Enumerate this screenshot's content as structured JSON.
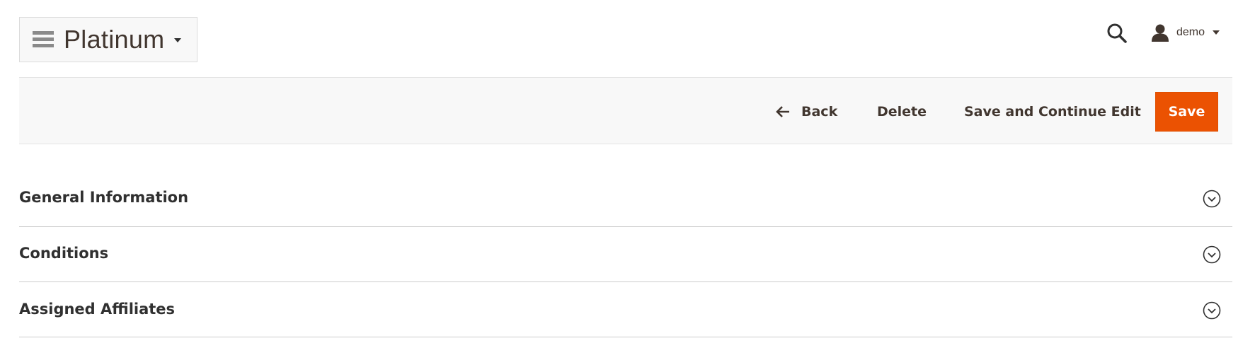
{
  "header": {
    "store_switcher": {
      "title": "Platinum"
    },
    "user": {
      "name": "demo"
    }
  },
  "actions": {
    "back_label": "Back",
    "delete_label": "Delete",
    "save_continue_label": "Save and Continue Edit",
    "save_label": "Save",
    "accent_color": "#eb5202"
  },
  "sections": [
    {
      "title": "General Information",
      "icon": "chevron-down-circle-icon"
    },
    {
      "title": "Conditions",
      "icon": "chevron-down-circle-icon"
    },
    {
      "title": "Assigned Affiliates",
      "icon": "chevron-down-circle-icon"
    }
  ]
}
